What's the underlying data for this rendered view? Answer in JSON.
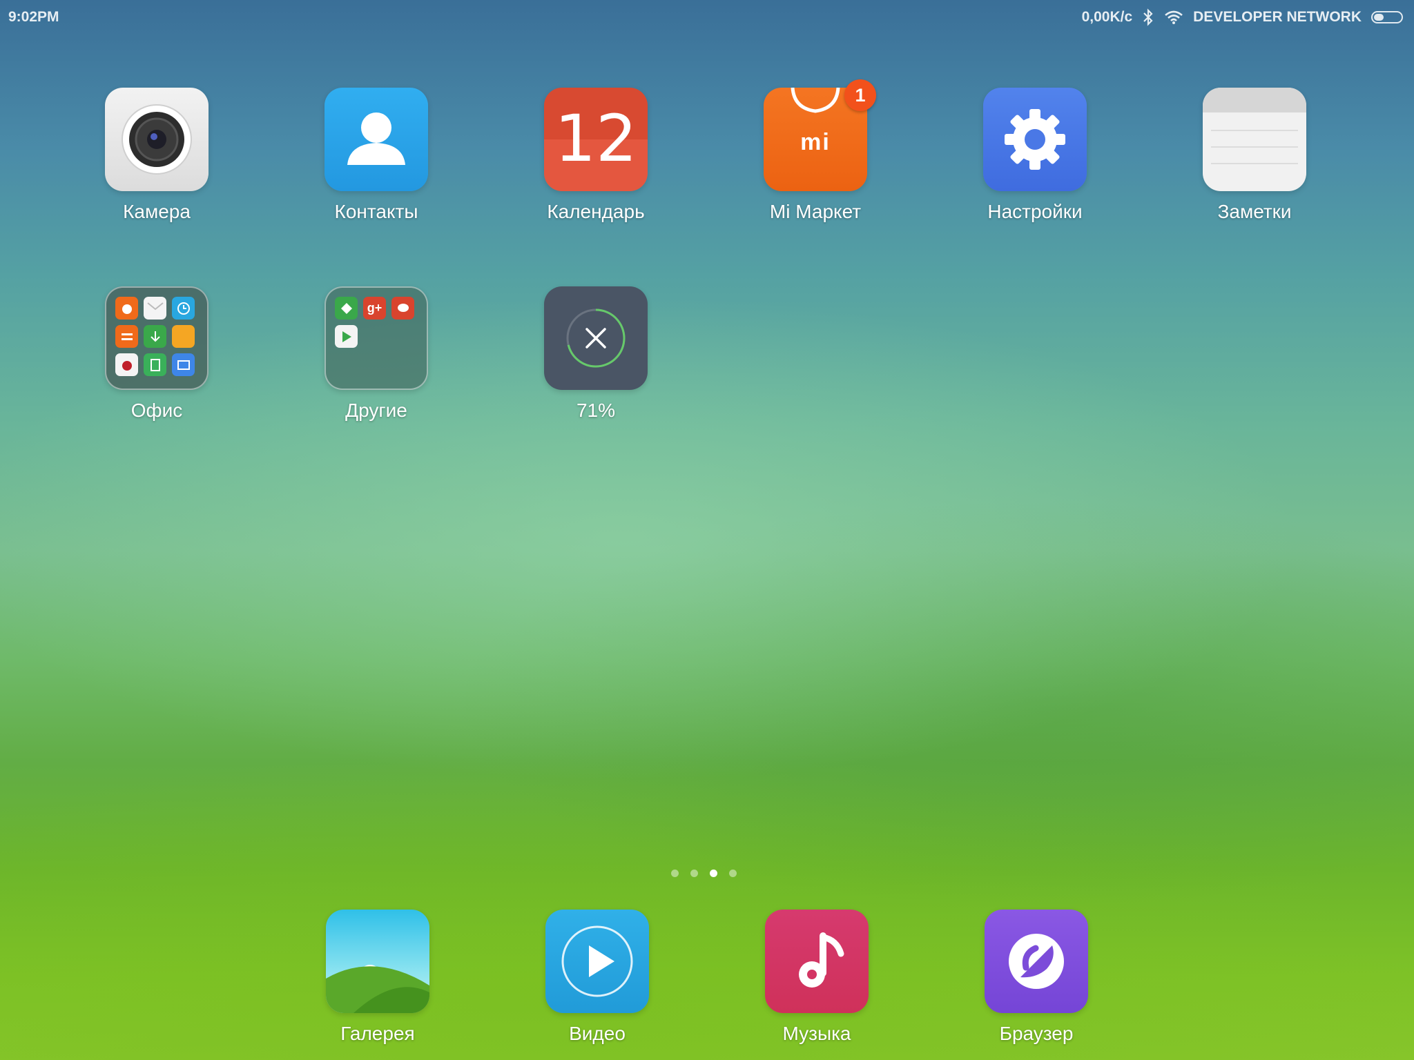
{
  "status_bar": {
    "time": "9:02PM",
    "speed": "0,00K/c",
    "network": "DEVELOPER NETWORK",
    "icons": [
      "bluetooth-icon",
      "wifi-icon",
      "battery-icon"
    ]
  },
  "apps": [
    {
      "label": "Камера",
      "icon": "camera-icon"
    },
    {
      "label": "Контакты",
      "icon": "contacts-icon"
    },
    {
      "label": "Календарь",
      "icon": "calendar-icon",
      "day": "12"
    },
    {
      "label": "Mi Маркет",
      "icon": "mi-market-icon",
      "logo": "mi",
      "badge": "1"
    },
    {
      "label": "Настройки",
      "icon": "settings-gear-icon"
    },
    {
      "label": "Заметки",
      "icon": "notes-icon"
    },
    {
      "label": "Офис",
      "icon": "office-folder-icon"
    },
    {
      "label": "Другие",
      "icon": "other-folder-icon"
    },
    {
      "label": "71%",
      "icon": "cleaner-icon",
      "progress": 0.71
    }
  ],
  "page_indicator": {
    "count": 4,
    "active": 3
  },
  "dock": [
    {
      "label": "Галерея",
      "icon": "gallery-icon"
    },
    {
      "label": "Видео",
      "icon": "video-play-icon"
    },
    {
      "label": "Музыка",
      "icon": "music-note-icon"
    },
    {
      "label": "Браузер",
      "icon": "browser-icon"
    }
  ],
  "colors": {
    "contacts": "#2aa4e8",
    "calendar": "#e0533a",
    "market": "#f06a1a",
    "settings": "#4a78e6",
    "cleaner": "#4a5565",
    "video": "#29a7e0",
    "music": "#d53766",
    "browser": "#8050dc",
    "badge": "#f2511b"
  }
}
